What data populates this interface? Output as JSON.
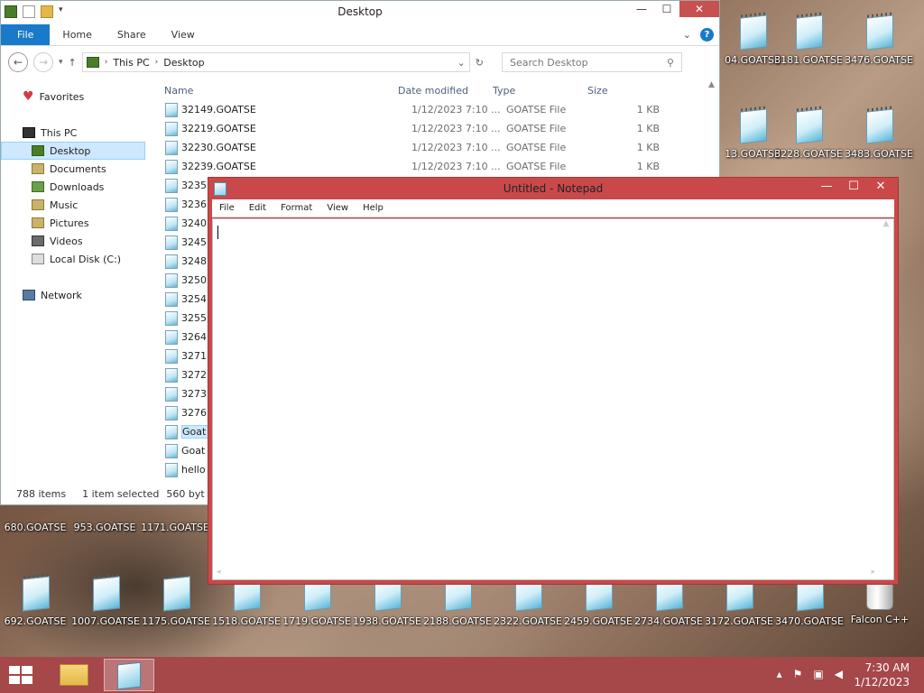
{
  "desktop": {
    "icons_right": [
      {
        "label": "04.GOATSE"
      },
      {
        "label": "3181.GOATSE"
      },
      {
        "label": "3476.GOATSE"
      },
      {
        "label": "13.GOATSE"
      },
      {
        "label": "3228.GOATSE"
      },
      {
        "label": "3483.GOATSE"
      }
    ],
    "icons_mid": [
      {
        "label": "680.GOATSE"
      },
      {
        "label": "953.GOATSE"
      },
      {
        "label": "1171.GOATSE"
      }
    ],
    "icons_bottom": [
      {
        "label": "692.GOATSE"
      },
      {
        "label": "1007.GOATSE"
      },
      {
        "label": "1175.GOATSE"
      },
      {
        "label": "1518.GOATSE"
      },
      {
        "label": "1719.GOATSE"
      },
      {
        "label": "1938.GOATSE"
      },
      {
        "label": "2188.GOATSE"
      },
      {
        "label": "2322.GOATSE"
      },
      {
        "label": "2459.GOATSE"
      },
      {
        "label": "2734.GOATSE"
      },
      {
        "label": "3172.GOATSE"
      },
      {
        "label": "3470.GOATSE"
      },
      {
        "label": "Falcon C++"
      }
    ]
  },
  "explorer": {
    "title": "Desktop",
    "tabs": {
      "file": "File",
      "home": "Home",
      "share": "Share",
      "view": "View"
    },
    "breadcrumb": {
      "root": "This PC",
      "current": "Desktop"
    },
    "search_placeholder": "Search Desktop",
    "nav": {
      "favorites": "Favorites",
      "this_pc": "This PC",
      "desktop": "Desktop",
      "documents": "Documents",
      "downloads": "Downloads",
      "music": "Music",
      "pictures": "Pictures",
      "videos": "Videos",
      "local_disk": "Local Disk (C:)",
      "network": "Network"
    },
    "columns": {
      "name": "Name",
      "date": "Date modified",
      "type": "Type",
      "size": "Size"
    },
    "files": [
      {
        "name": "32149.GOATSE",
        "date": "1/12/2023 7:10 ...",
        "type": "GOATSE File",
        "size": "1 KB"
      },
      {
        "name": "32219.GOATSE",
        "date": "1/12/2023 7:10 ...",
        "type": "GOATSE File",
        "size": "1 KB"
      },
      {
        "name": "32230.GOATSE",
        "date": "1/12/2023 7:10 ...",
        "type": "GOATSE File",
        "size": "1 KB"
      },
      {
        "name": "32239.GOATSE",
        "date": "1/12/2023 7:10 ...",
        "type": "GOATSE File",
        "size": "1 KB"
      },
      {
        "name": "3235",
        "date": "",
        "type": "",
        "size": ""
      },
      {
        "name": "3236",
        "date": "",
        "type": "",
        "size": ""
      },
      {
        "name": "3240",
        "date": "",
        "type": "",
        "size": ""
      },
      {
        "name": "3245",
        "date": "",
        "type": "",
        "size": ""
      },
      {
        "name": "3248",
        "date": "",
        "type": "",
        "size": ""
      },
      {
        "name": "3250",
        "date": "",
        "type": "",
        "size": ""
      },
      {
        "name": "3254",
        "date": "",
        "type": "",
        "size": ""
      },
      {
        "name": "3255",
        "date": "",
        "type": "",
        "size": ""
      },
      {
        "name": "3264",
        "date": "",
        "type": "",
        "size": ""
      },
      {
        "name": "3271",
        "date": "",
        "type": "",
        "size": ""
      },
      {
        "name": "3272",
        "date": "",
        "type": "",
        "size": ""
      },
      {
        "name": "3273",
        "date": "",
        "type": "",
        "size": ""
      },
      {
        "name": "3276",
        "date": "",
        "type": "",
        "size": ""
      },
      {
        "name": "Goat",
        "date": "",
        "type": "",
        "size": "",
        "selected": true
      },
      {
        "name": "Goat",
        "date": "",
        "type": "",
        "size": ""
      },
      {
        "name": "hello",
        "date": "",
        "type": "",
        "size": ""
      }
    ],
    "status": {
      "count": "788 items",
      "selected": "1 item selected",
      "size": "560 byt"
    }
  },
  "notepad": {
    "title": "Untitled - Notepad",
    "menu": {
      "file": "File",
      "edit": "Edit",
      "format": "Format",
      "view": "View",
      "help": "Help"
    }
  },
  "taskbar": {
    "time": "7:30 AM",
    "date": "1/12/2023"
  },
  "colors": {
    "accent": "#1979ca",
    "taskbar": "#a6474a",
    "notepad_frame": "#c9494b"
  }
}
